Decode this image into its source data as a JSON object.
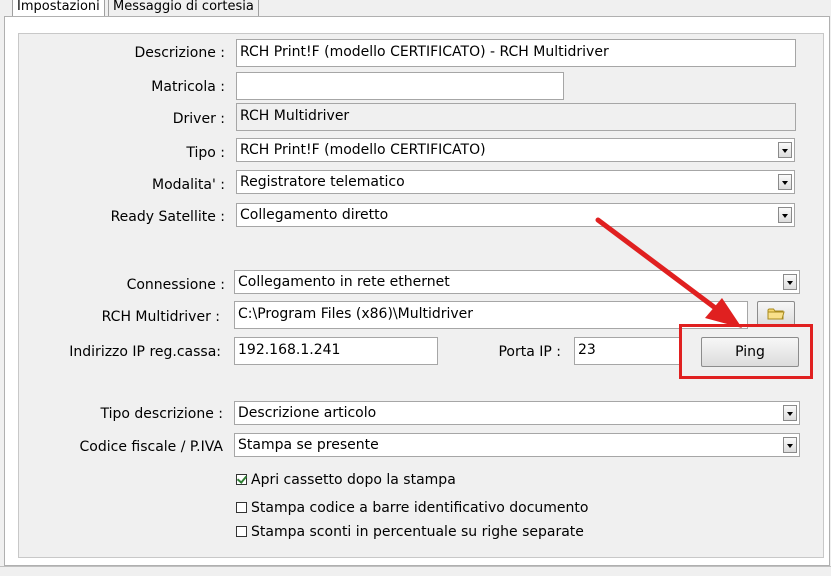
{
  "tabs": [
    {
      "label": "Impostazioni",
      "active": true
    },
    {
      "label": "Messaggio di cortesia",
      "active": false
    }
  ],
  "form": {
    "descrizione": {
      "label": "Descrizione :",
      "value": "RCH Print!F (modello CERTIFICATO) - RCH Multidriver"
    },
    "matricola": {
      "label": "Matricola :",
      "value": ""
    },
    "driver": {
      "label": "Driver :",
      "value": "RCH Multidriver"
    },
    "tipo": {
      "label": "Tipo :",
      "value": "RCH Print!F (modello CERTIFICATO)"
    },
    "modalita": {
      "label": "Modalita' :",
      "value": "Registratore telematico"
    },
    "ready_satellite": {
      "label": "Ready Satellite :",
      "value": "Collegamento diretto"
    },
    "connessione": {
      "label": "Connessione :",
      "value": "Collegamento in rete ethernet"
    },
    "rch_multidriver": {
      "label": "RCH Multidriver :",
      "value": "C:\\Program Files (x86)\\Multidriver"
    },
    "indirizzo_ip": {
      "label": "Indirizzo IP reg.cassa:",
      "value": "192.168.1.241"
    },
    "porta_ip": {
      "label": "Porta IP :",
      "value": "23"
    },
    "ping_button": "Ping",
    "tipo_descrizione": {
      "label": "Tipo descrizione :",
      "value": "Descrizione articolo"
    },
    "codice_fiscale": {
      "label": "Codice fiscale / P.IVA",
      "value": "Stampa se presente"
    }
  },
  "checkboxes": [
    {
      "label": "Apri cassetto dopo la stampa",
      "checked": true
    },
    {
      "label": "Stampa codice a barre identificativo documento",
      "checked": false
    },
    {
      "label": "Stampa sconti in percentuale su righe separate",
      "checked": false
    }
  ],
  "icons": {
    "browse": "folder-icon",
    "dropdown": "chevron-down-icon"
  },
  "colors": {
    "annotation": "#e02020",
    "check": "#2e7d32"
  }
}
